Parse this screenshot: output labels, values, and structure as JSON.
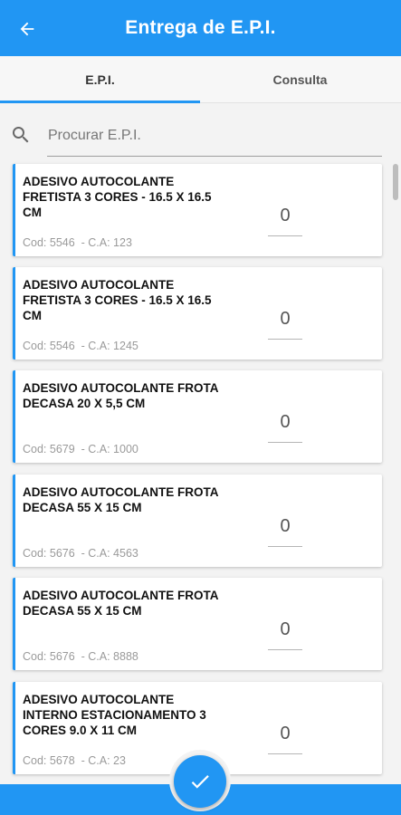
{
  "appbar": {
    "title": "Entrega de E.P.I.",
    "back_icon": "arrow-left-icon"
  },
  "tabs": [
    {
      "label": "E.P.I.",
      "selected": true
    },
    {
      "label": "Consulta",
      "selected": false
    }
  ],
  "search": {
    "placeholder": "Procurar E.P.I.",
    "value": "",
    "icon": "search-icon"
  },
  "items": [
    {
      "name": "ADESIVO AUTOCOLANTE FRETISTA 3 CORES - 16.5 X 16.5 CM",
      "sub": "Cod: 5546  - C.A: 123",
      "qty": "0"
    },
    {
      "name": "ADESIVO AUTOCOLANTE FRETISTA 3 CORES - 16.5 X 16.5 CM",
      "sub": "Cod: 5546  - C.A: 1245",
      "qty": "0"
    },
    {
      "name": "ADESIVO AUTOCOLANTE FROTA DECASA 20 X 5,5 CM",
      "sub": "Cod: 5679  - C.A: 1000",
      "qty": "0"
    },
    {
      "name": "ADESIVO AUTOCOLANTE FROTA DECASA 55 X 15 CM",
      "sub": "Cod: 5676  - C.A: 4563",
      "qty": "0"
    },
    {
      "name": "ADESIVO AUTOCOLANTE FROTA DECASA 55 X 15 CM",
      "sub": "Cod: 5676  - C.A: 8888",
      "qty": "0"
    },
    {
      "name": "ADESIVO AUTOCOLANTE INTERNO ESTACIONAMENTO 3 CORES 9.0 X 11 CM",
      "sub": "Cod: 5678  - C.A: 23",
      "qty": "0"
    }
  ],
  "fab": {
    "icon": "check-icon"
  },
  "colors": {
    "primary": "#2196f3",
    "background": "#f3f3f3",
    "card": "#ffffff",
    "muted_text": "#9a9a9a"
  }
}
